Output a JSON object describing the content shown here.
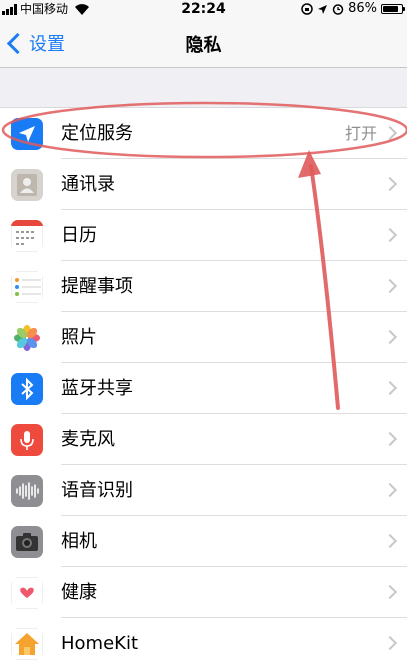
{
  "status_bar": {
    "carrier": "中国移动",
    "time": "22:24",
    "battery_percent": "86%",
    "battery_level": 0.86,
    "icons": [
      "signal-icon",
      "wifi-icon",
      "lock-rotation-icon",
      "location-arrow-icon",
      "alarm-icon",
      "battery-icon"
    ]
  },
  "nav": {
    "back_label": "设置",
    "title": "隐私"
  },
  "accent_color": "#1c7cf4",
  "annotation_color": "#e05a5a",
  "rows": [
    {
      "label": "定位服务",
      "value": "打开",
      "icon": "location-services-icon",
      "color": "#1a7cf5"
    },
    {
      "label": "通讯录",
      "value": "",
      "icon": "contacts-icon",
      "color": "#d6d3ce"
    },
    {
      "label": "日历",
      "value": "",
      "icon": "calendar-icon",
      "color": "#ffffff"
    },
    {
      "label": "提醒事项",
      "value": "",
      "icon": "reminders-icon",
      "color": "#ffffff"
    },
    {
      "label": "照片",
      "value": "",
      "icon": "photos-icon",
      "color": "#ffffff"
    },
    {
      "label": "蓝牙共享",
      "value": "",
      "icon": "bluetooth-icon",
      "color": "#1a7cf5"
    },
    {
      "label": "麦克风",
      "value": "",
      "icon": "microphone-icon",
      "color": "#ee4b3e"
    },
    {
      "label": "语音识别",
      "value": "",
      "icon": "speech-recognition-icon",
      "color": "#8e8e93"
    },
    {
      "label": "相机",
      "value": "",
      "icon": "camera-icon",
      "color": "#8e8e93"
    },
    {
      "label": "健康",
      "value": "",
      "icon": "health-icon",
      "color": "#ffffff"
    },
    {
      "label": "HomeKit",
      "value": "",
      "icon": "homekit-icon",
      "color": "#ffffff"
    }
  ]
}
